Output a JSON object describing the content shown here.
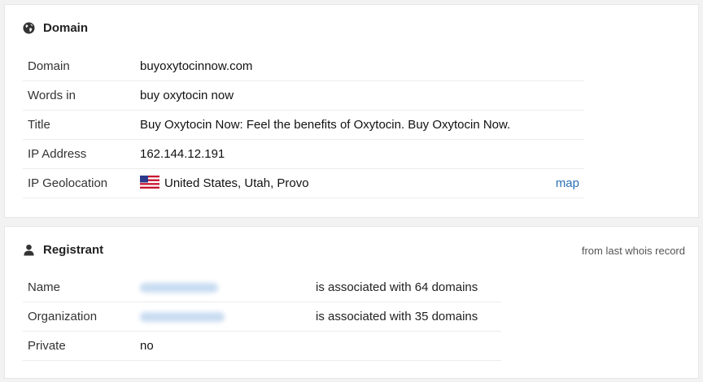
{
  "domain_panel": {
    "title": "Domain",
    "icon": "globe-icon",
    "rows": [
      {
        "label": "Domain",
        "value": "buyoxytocinnow.com"
      },
      {
        "label": "Words in",
        "value": "buy oxytocin now"
      },
      {
        "label": "Title",
        "value": "Buy Oxytocin Now: Feel the benefits of Oxytocin. Buy Oxytocin Now."
      },
      {
        "label": "IP Address",
        "value": "162.144.12.191"
      },
      {
        "label": "IP Geolocation",
        "value": "United States, Utah, Provo",
        "flag_icon": "us-flag-icon",
        "link": "map"
      }
    ]
  },
  "registrant_panel": {
    "title": "Registrant",
    "icon": "user-icon",
    "note": "from last whois record",
    "rows": [
      {
        "label": "Name",
        "association": "is associated with 64 domains"
      },
      {
        "label": "Organization",
        "association": "is associated with 35 domains"
      },
      {
        "label": "Private",
        "value": "no"
      }
    ]
  },
  "colors": {
    "link": "#2a6fb6",
    "background": "#f2f2f2",
    "panel": "#ffffff"
  }
}
